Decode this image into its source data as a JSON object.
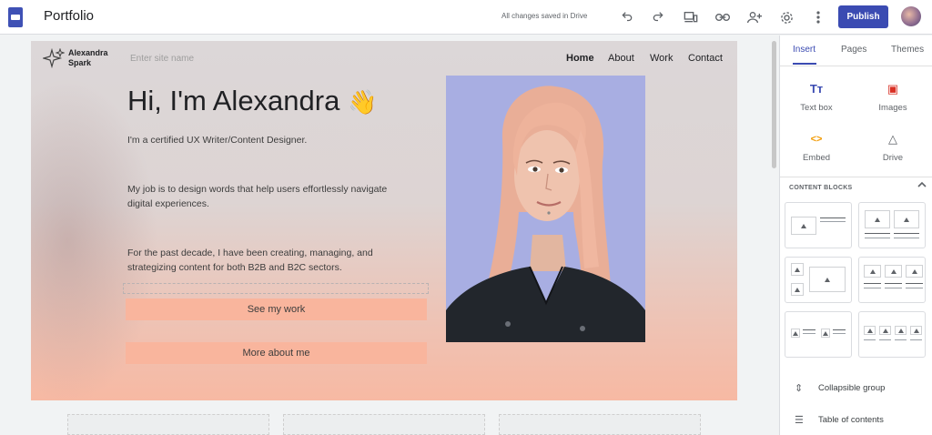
{
  "app": {
    "title": "Portfolio",
    "save_status": "All changes saved in Drive",
    "publish_label": "Publish"
  },
  "toolbar": {
    "icons": [
      "undo-icon",
      "redo-icon",
      "preview-icon",
      "link-icon",
      "share-icon",
      "settings-icon",
      "more-icon"
    ]
  },
  "site": {
    "logo_line1": "Alexandra",
    "logo_line2": "Spark",
    "site_name_placeholder": "Enter site name",
    "nav": [
      "Home",
      "About",
      "Work",
      "Contact"
    ],
    "active_nav": "Home"
  },
  "hero": {
    "greeting": "Hi, I'm Alexandra",
    "emoji": "👋",
    "intro": "I'm a certified UX Writer/Content Designer.",
    "job": "My job is to design words that help users effortlessly navigate digital experiences.",
    "decade": "For the past decade, I have been creating, managing, and strategizing content for both B2B and B2C sectors.",
    "btn_work": "See my work",
    "btn_about": "More about me"
  },
  "panel": {
    "tabs": [
      "Insert",
      "Pages",
      "Themes"
    ],
    "active_tab": "Insert",
    "insert_items": [
      {
        "label": "Text box",
        "icon": "text-box-icon",
        "glyph": "Tт",
        "color": "#3b4bb2"
      },
      {
        "label": "Images",
        "icon": "image-icon",
        "glyph": "▣",
        "color": "#d93025"
      },
      {
        "label": "Embed",
        "icon": "embed-icon",
        "glyph": "<>",
        "color": "#f29900"
      },
      {
        "label": "Drive",
        "icon": "drive-icon",
        "glyph": "△",
        "color": "#5f6368"
      }
    ],
    "content_blocks_heading": "CONTENT BLOCKS",
    "list": [
      {
        "label": "Collapsible group",
        "icon": "collapsible-group-icon",
        "glyph": "⇕"
      },
      {
        "label": "Table of contents",
        "icon": "table-of-contents-icon",
        "glyph": "☰"
      }
    ]
  },
  "colors": {
    "accent": "#3b4bb2",
    "cta": "#f9b59d",
    "photo_bg": "#a8aee2"
  }
}
